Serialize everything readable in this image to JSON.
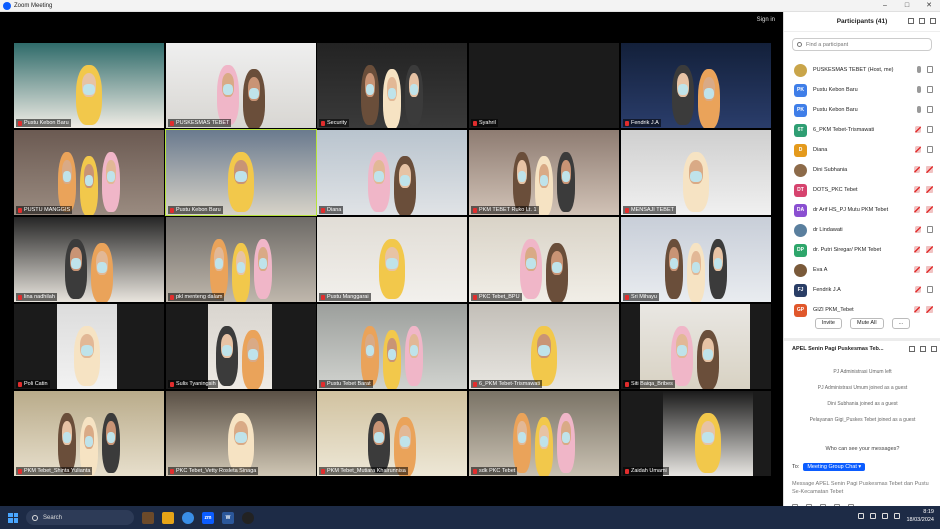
{
  "window": {
    "title": "Zoom Meeting",
    "signin_label": "Sign in"
  },
  "gallery": {
    "tiles": [
      {
        "name": "Pustu Kebon Baru"
      },
      {
        "name": "PUSKESMAS TEBET"
      },
      {
        "name": "Security"
      },
      {
        "name": "Syahril"
      },
      {
        "name": "Fendrik J.A"
      },
      {
        "name": "PUSTU MANGGIS"
      },
      {
        "name": "Pustu Kebon Baru"
      },
      {
        "name": "Diana"
      },
      {
        "name": "PKM TEBET Ruko Lt. 1"
      },
      {
        "name": "MENSAJI TEBET"
      },
      {
        "name": "lina nadhilah"
      },
      {
        "name": "pkl menteng dalam"
      },
      {
        "name": "Pustu Manggarai"
      },
      {
        "name": "PKC Tebet_BPU"
      },
      {
        "name": "Sri Mihayu"
      },
      {
        "name": "Poli Catin"
      },
      {
        "name": "Sulis Tyaningsih"
      },
      {
        "name": "Pustu Tebet Barat"
      },
      {
        "name": "6_PKM Tebet-Trismawati"
      },
      {
        "name": "Siti Baiqa_Bribes"
      },
      {
        "name": "PKM Tebet_Shinta Yulianta"
      },
      {
        "name": "PKC Tebet_Vetty Rosleta Sinaga"
      },
      {
        "name": "PKM Tebet_Mutiara Khairunnisa"
      },
      {
        "name": "sdk PKC Tebet"
      },
      {
        "name": "Zaidah Umami"
      }
    ]
  },
  "participants": {
    "header": "Participants (41)",
    "search_placeholder": "Find a participant",
    "items": [
      {
        "initials": "",
        "name": "PUSKESMAS TEBET (Host, me)",
        "color": "#c9a54a",
        "mic": "on",
        "cam": "on"
      },
      {
        "initials": "PK",
        "name": "Pustu Kebon Baru",
        "color": "#3f7ee8",
        "mic": "on",
        "cam": "on"
      },
      {
        "initials": "PK",
        "name": "Pustu Kebon Baru",
        "color": "#3f7ee8",
        "mic": "on",
        "cam": "on"
      },
      {
        "initials": "6T",
        "name": "6_PKM Tebet-Trismawati",
        "color": "#2f9e73",
        "mic": "off",
        "cam": "on"
      },
      {
        "initials": "D",
        "name": "Diana",
        "color": "#e49a1c",
        "mic": "off",
        "cam": "on"
      },
      {
        "initials": "",
        "name": "Dini Subhania",
        "color": "#8d6b4a",
        "mic": "off",
        "cam": "off"
      },
      {
        "initials": "DT",
        "name": "DOTS_PKC Tebet",
        "color": "#d6436e",
        "mic": "off",
        "cam": "off"
      },
      {
        "initials": "DA",
        "name": "dr Arif HS_PJ Mutu PKM Tebet",
        "color": "#8a4fd1",
        "mic": "off",
        "cam": "off"
      },
      {
        "initials": "",
        "name": "dr Lindawati",
        "color": "#5a7f9e",
        "mic": "off",
        "cam": "on"
      },
      {
        "initials": "DP",
        "name": "dr. Putri Siregar/ PKM Tebet",
        "color": "#2ea66b",
        "mic": "off",
        "cam": "off"
      },
      {
        "initials": "",
        "name": "Eva A",
        "color": "#7a5a3a",
        "mic": "off",
        "cam": "off"
      },
      {
        "initials": "FJ",
        "name": "Fendrik J.A",
        "color": "#2a3e66",
        "mic": "off",
        "cam": "on"
      },
      {
        "initials": "GP",
        "name": "GIZI PKM_Tebet",
        "color": "#e0572b",
        "mic": "off",
        "cam": "off"
      }
    ],
    "invite_label": "Invite",
    "mute_all_label": "Mute All",
    "more_label": "..."
  },
  "chat": {
    "header": "APEL Senin Pagi Puskesmas Teb...",
    "messages": [
      "PJ Administrasi Umum left",
      "PJ Administrasi Umum joined as a guest",
      "Dini Subhania joined as a guest",
      "Pelayanan Gigi_Puskes Tebet joined as a guest"
    ],
    "who_can_see": "Who can see your messages?",
    "to_label": "To:",
    "to_target": "Meeting Group Chat",
    "input_placeholder": "Message APEL Senin Pagi Puskesmas Tebet dan Pustu Se-Kecamatan Tebet"
  },
  "taskbar": {
    "search_label": "Search",
    "zoom_label": "zm",
    "word_label": "W",
    "time": "8:19",
    "date": "18/03/2024"
  }
}
